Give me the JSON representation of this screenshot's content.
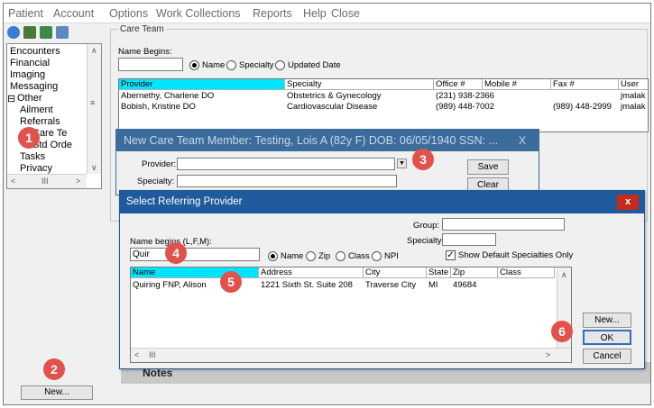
{
  "menu": [
    "Patient",
    "Account",
    "Options",
    "Work Collections",
    "Reports",
    "Help",
    "Close"
  ],
  "toolbar_icons": [
    "search-icon",
    "grid-icon",
    "chart-icon",
    "user-icon"
  ],
  "sidebar": {
    "items": [
      "Encounters",
      "Financial",
      "Imaging",
      "Messaging",
      "Other",
      "Ailment",
      "Referrals",
      "Care Te",
      "Std Orde",
      "Tasks",
      "Privacy"
    ],
    "new_button": "New..."
  },
  "care_team": {
    "group_title": "Care Team",
    "name_begins_label": "Name Begins:",
    "name_begins_value": "",
    "filters": [
      "Name",
      "Specialty",
      "Updated Date"
    ],
    "columns": [
      "Provider",
      "Specialty",
      "Office #",
      "Mobile #",
      "Fax #",
      "User"
    ],
    "rows": [
      [
        "Abernethy, Charlene DO",
        "Obstetrics & Gynecology",
        "(231) 938-2366",
        "",
        "",
        "jmalak"
      ],
      [
        "Bobish, Kristine DO",
        "Cardiovascular Disease",
        "(989) 448-7002",
        "",
        "(989) 448-2999",
        "jmalak"
      ]
    ]
  },
  "new_member_dialog": {
    "title": "New Care Team Member: Testing, Lois A   (82y F)   DOB: 06/05/1940   SSN: ...",
    "close": "X",
    "provider_label": "Provider:",
    "specialty_label": "Specialty:",
    "save": "Save",
    "clear": "Clear"
  },
  "referring_dialog": {
    "title": "Select Referring Provider",
    "close": "x",
    "group_label": "Group:",
    "specialty_label": "Specialty:",
    "name_begins_label": "Name begins (L,F,M):",
    "name_begins_value": "Quir",
    "radios": [
      "Name",
      "Zip",
      "Class",
      "NPI"
    ],
    "show_default_label": "Show Default Specialties Only",
    "show_default_checked": true,
    "columns": [
      "Name",
      "Address",
      "City",
      "State",
      "Zip",
      "Class"
    ],
    "rows": [
      [
        "Quiring FNP, Alison",
        "1221 Sixth St. Suite 208",
        "Traverse City",
        "MI",
        "49684",
        ""
      ]
    ],
    "new_button": "New...",
    "ok_button": "OK",
    "cancel_button": "Cancel"
  },
  "notes_label": "Notes",
  "steps": [
    "1",
    "2",
    "3",
    "4",
    "5",
    "6"
  ],
  "colors": {
    "badge": "#e0524b",
    "header_highlight": "#00e5ff",
    "dialog_title": "#1e5a9c",
    "close_red": "#c42b1c"
  }
}
